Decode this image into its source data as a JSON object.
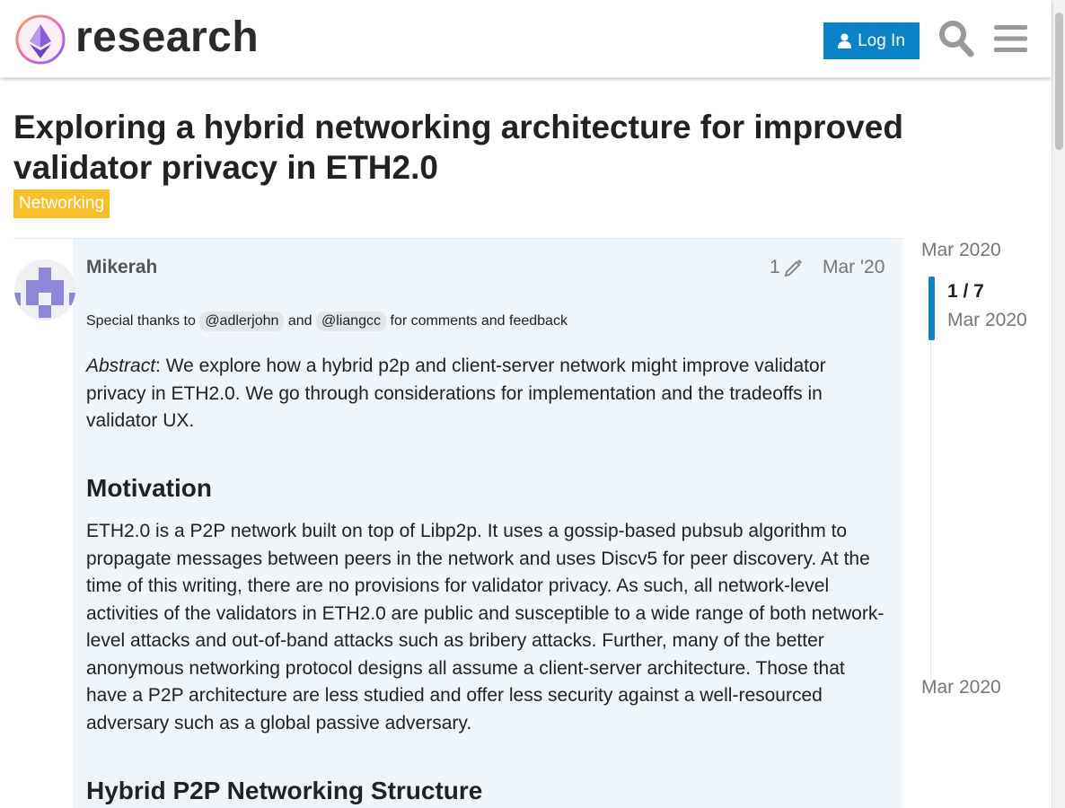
{
  "header": {
    "logo_text": "research",
    "login_label": "Log In",
    "search_icon": "search-icon",
    "menu_icon": "hamburger-menu-icon"
  },
  "topic": {
    "title": "Exploring a hybrid networking architecture for improved validator privacy in ETH2.0",
    "category": "Networking",
    "category_color": "#f7c02a"
  },
  "post": {
    "username": "Mikerah",
    "edit_count": "1",
    "date": "Mar '20",
    "thanks_prefix": "Special thanks to",
    "mention_1": "@adlerjohn",
    "thanks_and": "and",
    "mention_2": "@liangcc",
    "thanks_suffix": "for comments and feedback",
    "abstract_label": "Abstract",
    "abstract_text": ": We explore how a hybrid p2p and client-server network might improve validator privacy in ETH2.0. We go through considerations for implementation and the tradeoffs in validator UX.",
    "heading_motivation": "Motivation",
    "motivation_text": "ETH2.0 is a P2P network built on top of Libp2p. It uses a gossip-based pubsub algorithm to propagate messages between peers in the network and uses Discv5 for peer discovery. At the time of this writing, there are no provisions for validator privacy. As such, all network-level activities of the validators in ETH2.0 are public and susceptible to a wide range of both network-level attacks and out-of-band attacks such as bribery attacks. Further, many of the better anonymous networking protocol designs all assume a client-server architecture. Those that have a P2P architecture are less studied and offer less security against a well-resourced adversary such as a global passive adversary.",
    "heading_hybrid": "Hybrid P2P Networking Structure"
  },
  "timeline": {
    "top_date": "Mar 2020",
    "position": "1 / 7",
    "position_date": "Mar 2020",
    "bottom_date": "Mar 2020"
  },
  "colors": {
    "accent": "#0a82c8",
    "post_background": "#eef6fb"
  }
}
